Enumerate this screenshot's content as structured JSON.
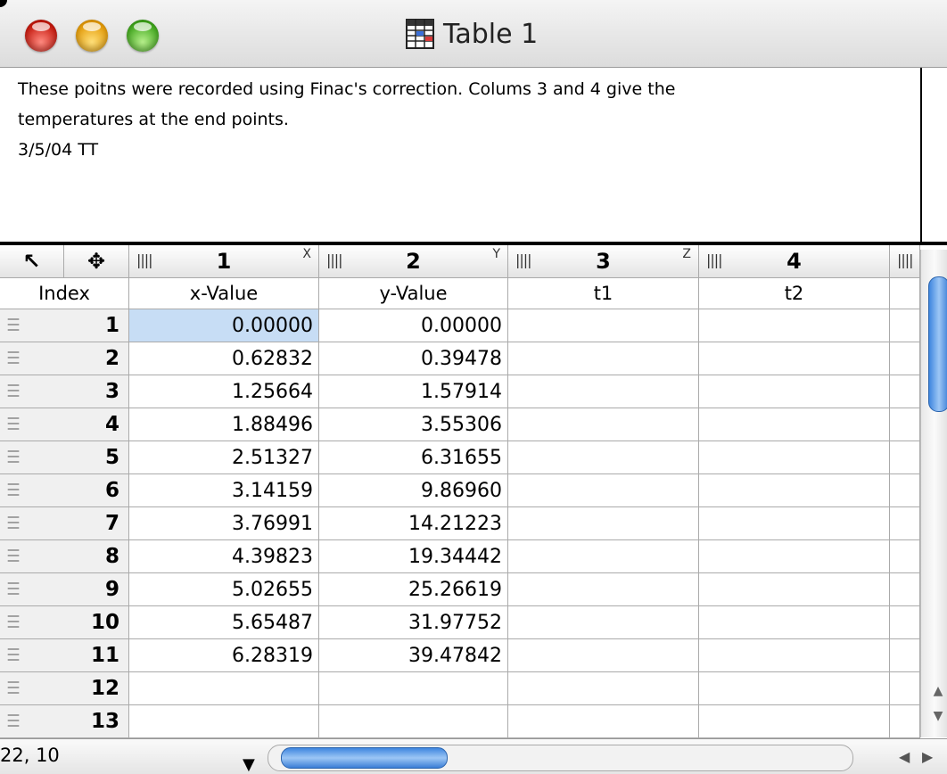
{
  "window": {
    "title": "Table 1"
  },
  "notes": {
    "lines": [
      "These poitns were recorded using Finac's correction. Colums 3 and 4 give the",
      "temperatures at the end points.",
      "",
      "3/5/04 TT"
    ]
  },
  "header_tools": {
    "select_icon": "↖",
    "move_icon": "✥"
  },
  "columns": [
    {
      "number": "1",
      "axis": "X",
      "name": "x-Value"
    },
    {
      "number": "2",
      "axis": "Y",
      "name": "y-Value"
    },
    {
      "number": "3",
      "axis": "Z",
      "name": "t1"
    },
    {
      "number": "4",
      "axis": "",
      "name": "t2"
    }
  ],
  "index_label": "Index",
  "rows": [
    {
      "index": "1",
      "x": "0.00000",
      "y": "0.00000",
      "t1": "",
      "t2": ""
    },
    {
      "index": "2",
      "x": "0.62832",
      "y": "0.39478",
      "t1": "",
      "t2": ""
    },
    {
      "index": "3",
      "x": "1.25664",
      "y": "1.57914",
      "t1": "",
      "t2": ""
    },
    {
      "index": "4",
      "x": "1.88496",
      "y": "3.55306",
      "t1": "",
      "t2": ""
    },
    {
      "index": "5",
      "x": "2.51327",
      "y": "6.31655",
      "t1": "",
      "t2": ""
    },
    {
      "index": "6",
      "x": "3.14159",
      "y": "9.86960",
      "t1": "",
      "t2": ""
    },
    {
      "index": "7",
      "x": "3.76991",
      "y": "14.21223",
      "t1": "",
      "t2": ""
    },
    {
      "index": "8",
      "x": "4.39823",
      "y": "19.34442",
      "t1": "",
      "t2": ""
    },
    {
      "index": "9",
      "x": "5.02655",
      "y": "25.26619",
      "t1": "",
      "t2": ""
    },
    {
      "index": "10",
      "x": "5.65487",
      "y": "31.97752",
      "t1": "",
      "t2": ""
    },
    {
      "index": "11",
      "x": "6.28319",
      "y": "39.47842",
      "t1": "",
      "t2": ""
    },
    {
      "index": "12",
      "x": "",
      "y": "",
      "t1": "",
      "t2": ""
    },
    {
      "index": "13",
      "x": "",
      "y": "",
      "t1": "",
      "t2": ""
    }
  ],
  "status": {
    "cell_ref": "22, 10"
  },
  "colors": {
    "selection": "#c7ddf5",
    "scroll_thumb": "#3f86df"
  }
}
